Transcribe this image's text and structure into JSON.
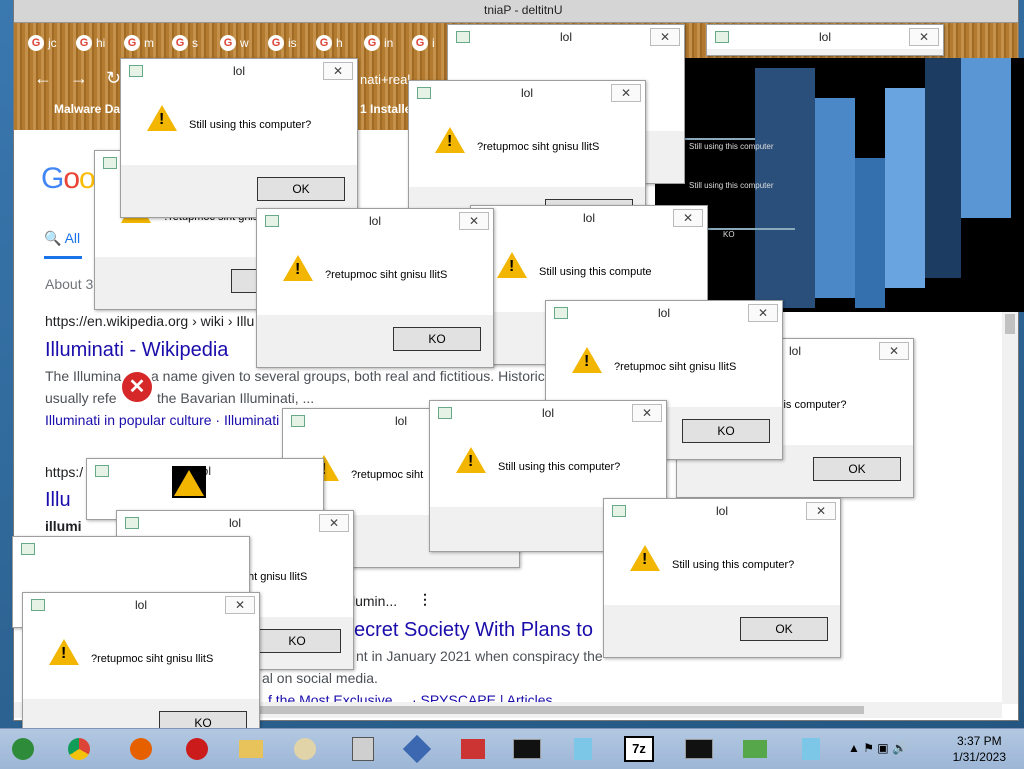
{
  "browser": {
    "window_title": "tniaP - deltitnU",
    "tab_label_fragments": [
      "jc",
      "hi",
      "m",
      "s",
      "w",
      "is",
      "h",
      "in",
      "i"
    ],
    "address_fragment": "nati+real",
    "bookmarks": [
      "Malware Dat",
      "1 Installe"
    ],
    "google_logo": "Goo",
    "search_tab": "All",
    "about": "About 3",
    "results": {
      "r1_url": "https://en.wikipedia.org › wiki › Illu",
      "r1_title": "Illuminati - Wikipedia",
      "r1_text_a": "The Illumina",
      "r1_text_b": "a name given to several groups, both real and fictitious. Historic",
      "r1_text_c": "usually refe",
      "r1_text_d": "the Bavarian Illuminati, ...",
      "r1_links": "Illuminati in popular culture · Illuminati",
      "r2_url": "https:/",
      "r2_title": "Illu",
      "r2_text": "illumi",
      "r3_url_frag": "lumin...",
      "r3_title": "ecret Society With Plans to",
      "r3_text_a": "nt in January 2021 when conspiracy the",
      "r3_text_b": "al on social media.",
      "r3_link": "f the Most Exclusive ... · SPYSCAPE | Articles"
    }
  },
  "dialog_title": "lol",
  "dialogs": [
    {
      "msg": "Still using this computer?",
      "btn": "OK"
    },
    {
      "msg": "?retupmoc siht gnisu llitS",
      "btn": "KO"
    },
    {
      "msg": "?retupmoc siht gnisu llitS",
      "btn": "KO"
    },
    {
      "msg": "Still using this compute",
      "btn": "OK"
    },
    {
      "msg": "?retupmoc siht gnisu llitS",
      "btn": "KO"
    },
    {
      "msg": "ng this computer?",
      "btn": "OK"
    },
    {
      "msg": "?retupmoc siht",
      "btn": "KO"
    },
    {
      "msg": "Still using this computer?",
      "btn": "OK"
    },
    {
      "msg": "?retupmoc siht gnisu llitS",
      "btn": "KO"
    },
    {
      "msg": "Still using this computer?",
      "btn": "OK"
    },
    {
      "msg": "?retupmoc siht gnisu llitS",
      "btn": "KO"
    },
    {
      "msg": "?retupmoc siht gnisu llitS",
      "btn": "KO"
    },
    {
      "msg": "?retupmoc sih",
      "btn": "KO"
    }
  ],
  "glitch_texts": [
    "Still using this computer",
    "Still using this computer",
    "KO"
  ],
  "taskbar": {
    "apps": [
      "chrome-icon",
      "firefox-icon",
      "folder-icon",
      "paint-icon",
      "calc-icon",
      "vlc-icon",
      "toolbox-icon",
      "cmd-icon",
      "notepad-icon",
      "7zip-icon",
      "cmd-icon",
      "migrate-icon",
      "notepad-icon"
    ],
    "zip_label": "7z",
    "time": "3:37 PM",
    "date": "1/31/2023"
  }
}
